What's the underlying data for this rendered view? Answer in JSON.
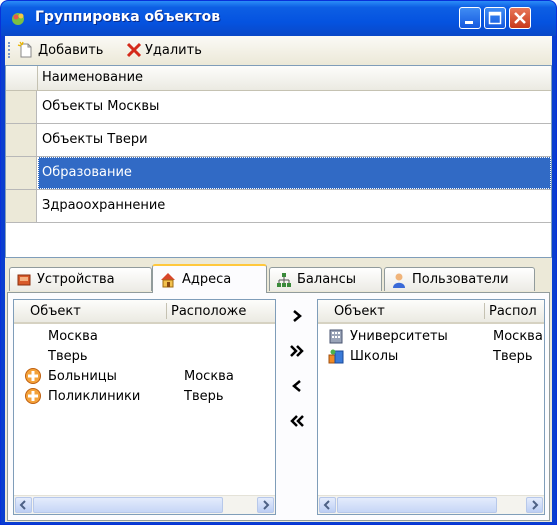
{
  "window": {
    "title": "Группировка объектов"
  },
  "toolbar": {
    "add_label": "Добавить",
    "delete_label": "Удалить"
  },
  "grid": {
    "header": "Наименование",
    "rows": [
      "Объекты Москвы",
      "Объекты Твери",
      "Образование",
      "Здраоохраннение"
    ],
    "selected_index": 2
  },
  "tabs": [
    {
      "label": "Устройства",
      "icon": "device-icon"
    },
    {
      "label": "Адреса",
      "icon": "home-icon"
    },
    {
      "label": "Балансы",
      "icon": "hierarchy-icon"
    },
    {
      "label": "Пользователи",
      "icon": "user-icon"
    }
  ],
  "active_tab": 1,
  "left_list": {
    "columns": [
      "Объект",
      "Расположе"
    ],
    "items": [
      {
        "name": "Москва",
        "location": "",
        "icon": ""
      },
      {
        "name": "Тверь",
        "location": "",
        "icon": ""
      },
      {
        "name": "Больницы",
        "location": "Москва",
        "icon": "medical-cross-icon"
      },
      {
        "name": "Поликлиники",
        "location": "Тверь",
        "icon": "medical-cross-icon"
      }
    ]
  },
  "right_list": {
    "columns": [
      "Объект",
      "Распол"
    ],
    "items": [
      {
        "name": "Университеты",
        "location": "Москва",
        "icon": "building-icon"
      },
      {
        "name": "Школы",
        "location": "Тверь",
        "icon": "school-icon"
      }
    ]
  },
  "transfer_buttons": {
    "move_right": "›",
    "move_all_right": "»",
    "move_left": "‹",
    "move_all_left": "«"
  },
  "colors": {
    "selection": "#316ac5",
    "titlebar": "#0553e0",
    "close": "#c8391a",
    "active_tab_accent": "#ffc83c"
  }
}
